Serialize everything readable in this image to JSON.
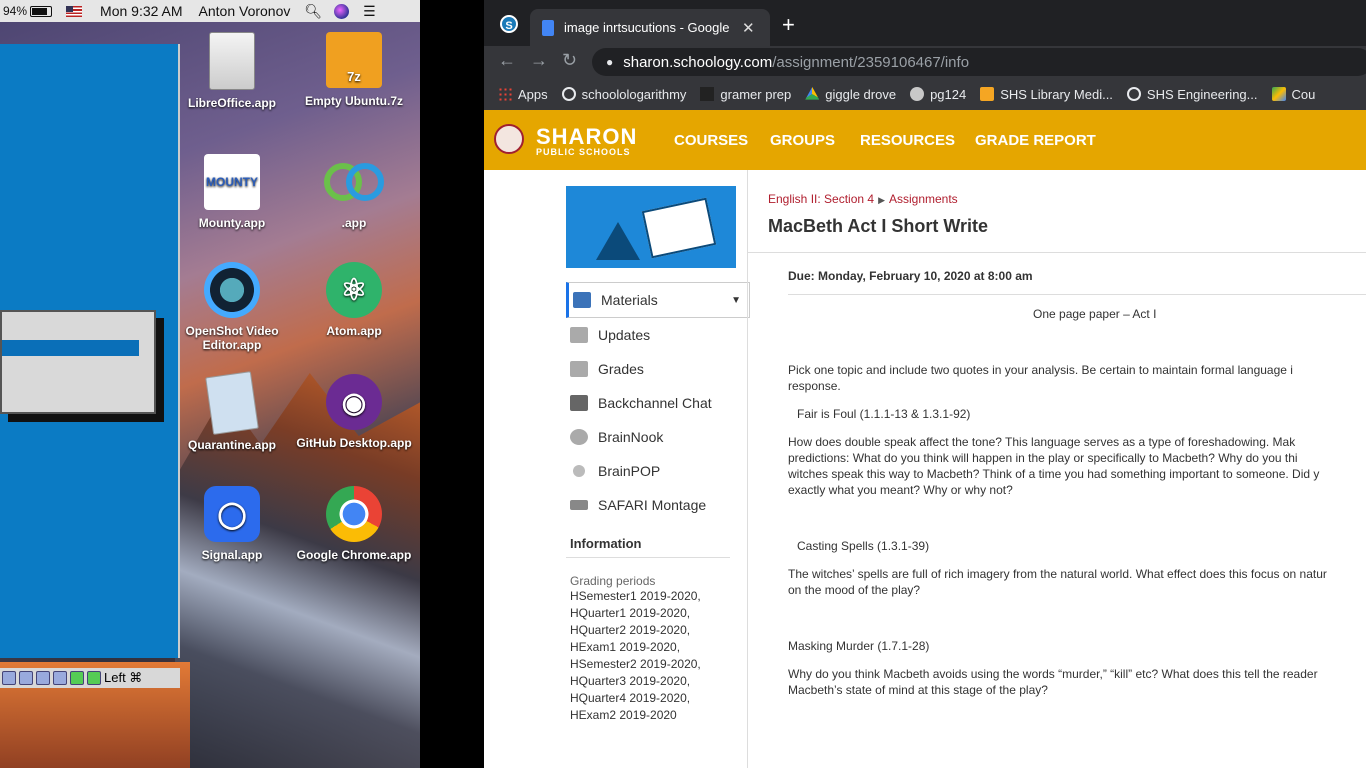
{
  "menubar": {
    "battery": "94%",
    "clock": "Mon 9:32 AM",
    "user": "Anton Voronov"
  },
  "desktop": {
    "icons": [
      {
        "label": "LibreOffice.app",
        "icon": "document-icon"
      },
      {
        "label": "Empty Ubuntu.7z",
        "icon": "archive-icon",
        "badge": "7z"
      },
      {
        "label": "Mounty.app",
        "icon": "mounty-icon",
        "badge": "MOUNTY"
      },
      {
        "label": ".app",
        "icon": "rings-icon"
      },
      {
        "label": "OpenShot Video Editor.app",
        "icon": "openshot-icon"
      },
      {
        "label": "Atom.app",
        "icon": "atom-icon"
      },
      {
        "label": "Quarantine.app",
        "icon": "quarantine-icon"
      },
      {
        "label": "GitHub Desktop.app",
        "icon": "github-icon"
      },
      {
        "label": "Signal.app",
        "icon": "signal-icon"
      },
      {
        "label": "Google Chrome.app",
        "icon": "chrome-icon"
      }
    ],
    "vbox_status": "Left ⌘"
  },
  "browser": {
    "tab_title": "image inrtsucutions - Google D",
    "url_host": "sharon.schoology.com",
    "url_path": "/assignment/2359106467/info",
    "bookmarks": [
      {
        "label": "Apps",
        "icon": "apps-icon"
      },
      {
        "label": "schoolologarithmy",
        "icon": "schoology-icon"
      },
      {
        "label": "gramer prep",
        "icon": "gb-icon"
      },
      {
        "label": "giggle drove",
        "icon": "drive-icon"
      },
      {
        "label": "pg124",
        "icon": "globe-icon"
      },
      {
        "label": "SHS Library Medi...",
        "icon": "library-icon"
      },
      {
        "label": "SHS Engineering...",
        "icon": "schoology-icon"
      },
      {
        "label": "Cou",
        "icon": "maps-icon"
      }
    ]
  },
  "schoology": {
    "brand_main": "SHARON",
    "brand_sub": "PUBLIC SCHOOLS",
    "nav": [
      "COURSES",
      "GROUPS",
      "RESOURCES",
      "GRADE REPORT"
    ],
    "menu": [
      {
        "label": "Materials",
        "icon": "materials-icon"
      },
      {
        "label": "Updates",
        "icon": "updates-icon"
      },
      {
        "label": "Grades",
        "icon": "grades-icon"
      },
      {
        "label": "Backchannel Chat",
        "icon": "chat-icon"
      },
      {
        "label": "BrainNook",
        "icon": "brainnook-icon"
      },
      {
        "label": "BrainPOP",
        "icon": "brainpop-icon"
      },
      {
        "label": "SAFARI Montage",
        "icon": "safari-montage-icon"
      }
    ],
    "info_heading": "Information",
    "grading_label": "Grading periods",
    "grading_periods": [
      "HSemester1 2019-2020,",
      "HQuarter1 2019-2020,",
      "HQuarter2 2019-2020,",
      "HExam1 2019-2020,",
      "HSemester2 2019-2020,",
      "HQuarter3 2019-2020,",
      "HQuarter4 2019-2020,",
      "HExam2 2019-2020"
    ],
    "breadcrumb": {
      "course": "English II: Section 4",
      "section": "Assignments"
    },
    "title": "MacBeth Act I Short Write",
    "due": "Due: Monday, February 10, 2020 at 8:00 am",
    "body": {
      "subtitle": "One page paper – Act I",
      "intro1": "Pick one topic and include two quotes in your analysis.  Be certain to maintain formal language i",
      "intro2": "response.",
      "topic1": "Fair is Foul (1.1.1-13 & 1.3.1-92)",
      "t1l1": "How does double speak affect the tone?  This language serves as a type of foreshadowing.  Mak",
      "t1l2": "predictions: What do you think will happen in the play or specifically to Macbeth?  Why do you thi",
      "t1l3": "witches speak this way to Macbeth?  Think of a time you had something important to someone.  Did y",
      "t1l4": "exactly what you meant? Why or why not?",
      "topic2": "Casting Spells (1.3.1-39)",
      "t2l1": "The witches’ spells are full of rich imagery from the natural world.  What effect does this focus on natur",
      "t2l2": "on the mood of the play?",
      "topic3": "Masking Murder (1.7.1-28)",
      "t3l1": "Why do you think Macbeth avoids using the words “murder,” “kill” etc?  What does this tell the reader",
      "t3l2": "Macbeth’s state of mind at this stage of the play?"
    }
  }
}
